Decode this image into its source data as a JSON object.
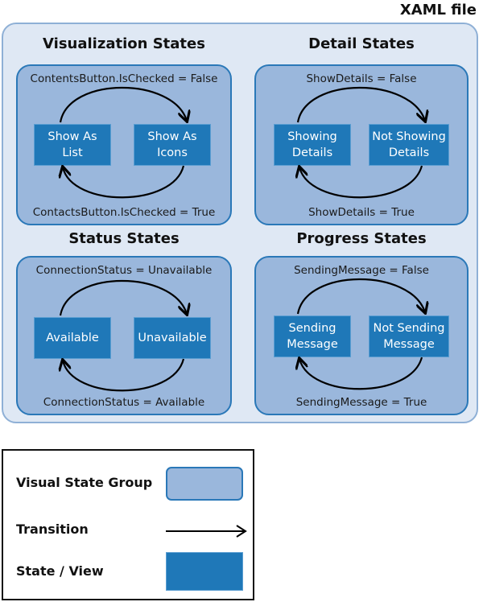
{
  "title": "XAML file",
  "groups": [
    {
      "name": "Visualization States",
      "top_condition": "ContentsButton.IsChecked = False",
      "bottom_condition": "ContactsButton.IsChecked = True",
      "states": [
        "Show As\nList",
        "Show As\nIcons"
      ]
    },
    {
      "name": "Detail States",
      "top_condition": "ShowDetails = False",
      "bottom_condition": "ShowDetails = True",
      "states": [
        "Showing\nDetails",
        "Not Showing\nDetails"
      ]
    },
    {
      "name": "Status States",
      "top_condition": "ConnectionStatus = Unavailable",
      "bottom_condition": "ConnectionStatus = Available",
      "states": [
        "Available",
        "Unavailable"
      ]
    },
    {
      "name": "Progress States",
      "top_condition": "SendingMessage = False",
      "bottom_condition": "SendingMessage = True",
      "states": [
        "Sending\nMessage",
        "Not Sending\nMessage"
      ]
    }
  ],
  "legend": {
    "group_label": "Visual State Group",
    "transition_label": "Transition",
    "state_label": "State / View"
  },
  "colors": {
    "container_fill": "#dfe8f4",
    "group_fill": "#9ab7dc",
    "group_border": "#2a78b8",
    "state_fill": "#1f78b8"
  }
}
